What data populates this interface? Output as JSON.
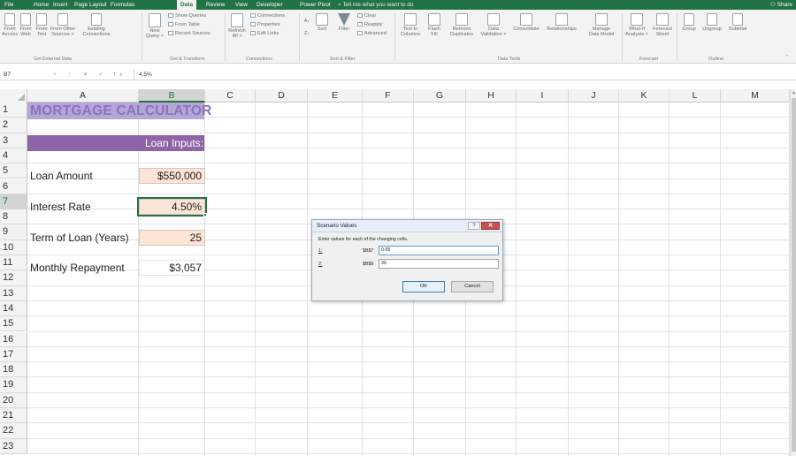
{
  "menu": {
    "tabs": [
      "File",
      "Home",
      "Insert",
      "Page Layout",
      "Formulas",
      "Data",
      "Review",
      "View",
      "Developer",
      "Power Pivot"
    ],
    "active_tab": "Data",
    "tell_me": "⌕ Tell me what you want to do",
    "share": "⚇ Share"
  },
  "ribbon": {
    "get_external": {
      "buttons": [
        "From\nAccess",
        "From\nWeb",
        "From\nText",
        "From Other\nSources ˅",
        "Existing\nConnections"
      ],
      "label": "Get External Data"
    },
    "get_transform": {
      "new_query": "New\nQuery ˅",
      "small": [
        "Show Queries",
        "From Table",
        "Recent Sources"
      ],
      "label": "Get & Transform"
    },
    "connections": {
      "refresh": "Refresh\nAll ˅",
      "small": [
        "Connections",
        "Properties",
        "Edit Links"
      ],
      "label": "Connections"
    },
    "sort_filter": {
      "sort": "Sort",
      "filter": "Filter",
      "small": [
        "Clear",
        "Reapply",
        "Advanced"
      ],
      "label": "Sort & Filter"
    },
    "data_tools": {
      "buttons": [
        "Text to\nColumns",
        "Flash\nFill",
        "Remove\nDuplicates",
        "Data\nValidation ˅",
        "Consolidate",
        "Relationships",
        "Manage\nData Model"
      ],
      "label": "Data Tools"
    },
    "forecast": {
      "buttons": [
        "What-If\nAnalysis ˅",
        "Forecast\nSheet"
      ],
      "label": "Forecast"
    },
    "outline": {
      "buttons": [
        "Group",
        "Ungroup",
        "Subtotal"
      ],
      "label": "Outline"
    }
  },
  "formula_bar": {
    "name_box": "B7",
    "icons": "˅ ⋮ ✕ ✓ fx",
    "value": "4.5%"
  },
  "grid": {
    "columns": [
      "A",
      "B",
      "C",
      "D",
      "E",
      "F",
      "G",
      "H",
      "I",
      "J",
      "K",
      "L",
      "M"
    ],
    "rows": [
      "1",
      "2",
      "3",
      "4",
      "5",
      "6",
      "7",
      "8",
      "9",
      "10",
      "11",
      "12",
      "13",
      "14",
      "15",
      "16",
      "17",
      "18",
      "19",
      "20",
      "21",
      "22",
      "23"
    ],
    "selected_column": "B",
    "selected_row": "7"
  },
  "sheet": {
    "title": "MORTGAGE CALCULATOR",
    "inputs_header": "Loan Inputs:",
    "loan_amount_label": "Loan Amount",
    "loan_amount_value": "$550,000",
    "interest_rate_label": "Interest Rate",
    "interest_rate_value": "4.50%",
    "term_label": "Term of Loan (Years)",
    "term_value": "25",
    "monthly_label": "Monthly Repayment",
    "monthly_value": "$3,057"
  },
  "dialog": {
    "title": "Scenario Values",
    "help": "?",
    "close": "✕",
    "instructions": "Enter values for each of the changing cells.",
    "fields": [
      {
        "num": "1:",
        "ref": "$B$7",
        "value": "0.05"
      },
      {
        "num": "2:",
        "ref": "$B$9",
        "value": "30"
      }
    ],
    "ok": "OK",
    "cancel": "Cancel"
  },
  "colors": {
    "excel_green": "#217346",
    "title_fill": "#b4a7d6",
    "title_text": "#9070c0",
    "band": "#8e63a8",
    "input_fill": "#fce4d6"
  }
}
